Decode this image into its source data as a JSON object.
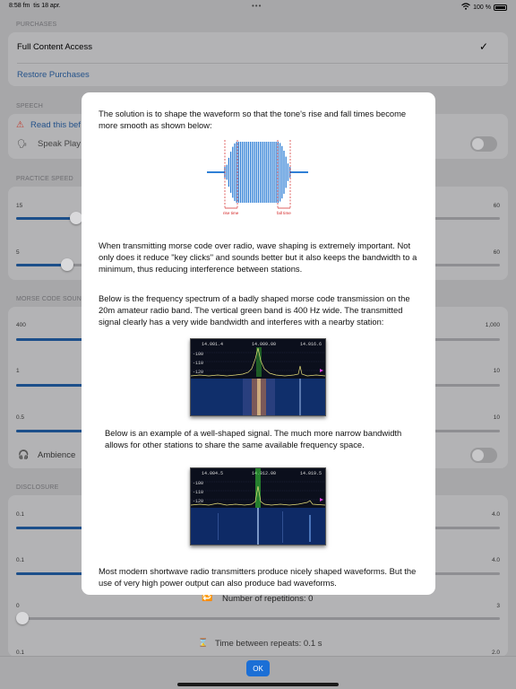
{
  "status_bar": {
    "time": "8:58 fm",
    "date": "tis 18 apr.",
    "battery": "100 %"
  },
  "purchases": {
    "header": "PURCHASES",
    "full_access": "Full Content Access",
    "restore": "Restore Purchases"
  },
  "speech": {
    "header": "SPEECH",
    "read_this": "Read this bef",
    "speak_play": "Speak Play"
  },
  "practice_speed": {
    "header": "PRACTICE SPEED",
    "slider1_min": "15",
    "slider1_max": "60",
    "slider2_min": "5",
    "slider2_max": "60"
  },
  "morse_sound": {
    "header": "MORSE CODE SOUN",
    "slider1_min": "400",
    "slider1_max": "1,000",
    "slider2_min": "1",
    "slider2_max": "10",
    "slider3_min": "0.5",
    "slider3_max": "10",
    "ambience": "Ambience"
  },
  "disclosure": {
    "header": "DISCLOSURE",
    "slider1_min": "0.1",
    "slider1_max": "4.0",
    "slider2_min": "0.1",
    "slider2_max": "4.0",
    "repetitions": "Number of repetitions: 0",
    "rep_min": "0",
    "rep_max": "3",
    "between_repeats": "Time between repeats: 0.1 s",
    "between_min": "0.1",
    "between_max": "2.0"
  },
  "ok_label": "OK",
  "modal": {
    "para1": "The solution is to shape the waveform so that the tone's rise and fall times become more smooth as shown below:",
    "rise_time": "rise time",
    "fall_time": "fall time",
    "para2": "When transmitting morse code over radio, wave shaping is extremely important. Not only does it reduce \"key clicks\" and sounds better but it also keeps the bandwidth to a minimum, thus reducing interference between stations.",
    "para3": "Below is the frequency spectrum of a badly shaped morse code transmission on the 20m amateur radio band. The vertical green band is 400 Hz wide. The transmitted signal clearly has a very wide bandwidth and interferes with a nearby station:",
    "spectrum1": {
      "f_left": "14.001.4",
      "f_center": "14.009.00",
      "f_right": "14.016.6",
      "levels": [
        "-100",
        "-110",
        "-120"
      ]
    },
    "para4": "Below is an example of a well-shaped signal. The much more narrow bandwidth allows for other stations to share the same available frequency space.",
    "spectrum2": {
      "f_left": "14.004.5",
      "f_center": "14.012.00",
      "f_right": "14.019.5",
      "levels": [
        "-100",
        "-110",
        "-120"
      ]
    },
    "para5": "Most modern shortwave radio transmitters produce nicely shaped waveforms. But the use of very high power output can also produce bad waveforms."
  },
  "colors": {
    "wave": "#2f7fd6",
    "rise_fall_marker": "#d21f1f",
    "accent": "#1b6fd6",
    "spectrum_signal": "#3ddc3d"
  }
}
